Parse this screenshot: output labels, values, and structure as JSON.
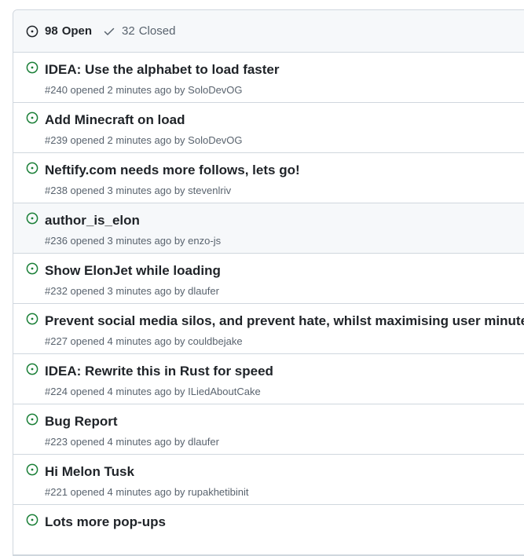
{
  "header": {
    "open_count": "98",
    "open_label": "Open",
    "closed_count": "32",
    "closed_label": "Closed"
  },
  "colors": {
    "open_icon": "#1a7f37",
    "border": "#d0d7de",
    "header_bg": "#f6f8fa",
    "muted_text": "#59636e"
  },
  "issues": [
    {
      "title": "IDEA: Use the alphabet to load faster",
      "number": "#240",
      "opened": "opened 2 minutes ago by",
      "author": "SoloDevOG"
    },
    {
      "title": "Add Minecraft on load",
      "number": "#239",
      "opened": "opened 2 minutes ago by",
      "author": "SoloDevOG"
    },
    {
      "title": "Neftify.com needs more follows, lets go!",
      "number": "#238",
      "opened": "opened 3 minutes ago by",
      "author": "stevenlriv"
    },
    {
      "title": "author_is_elon",
      "number": "#236",
      "opened": "opened 3 minutes ago by",
      "author": "enzo-js"
    },
    {
      "title": "Show ElonJet while loading",
      "number": "#232",
      "opened": "opened 3 minutes ago by",
      "author": "dlaufer"
    },
    {
      "title": "Prevent social media silos, and prevent hate, whilst maximising user minutes",
      "number": "#227",
      "opened": "opened 4 minutes ago by",
      "author": "couldbejake"
    },
    {
      "title": "IDEA: Rewrite this in Rust for speed",
      "number": "#224",
      "opened": "opened 4 minutes ago by",
      "author": "ILiedAboutCake"
    },
    {
      "title": "Bug Report",
      "number": "#223",
      "opened": "opened 4 minutes ago by",
      "author": "dlaufer"
    },
    {
      "title": "Hi Melon Tusk",
      "number": "#221",
      "opened": "opened 4 minutes ago by",
      "author": "rupakhetibinit"
    },
    {
      "title": "Lots more pop-ups",
      "number": "",
      "opened": "",
      "author": ""
    }
  ]
}
